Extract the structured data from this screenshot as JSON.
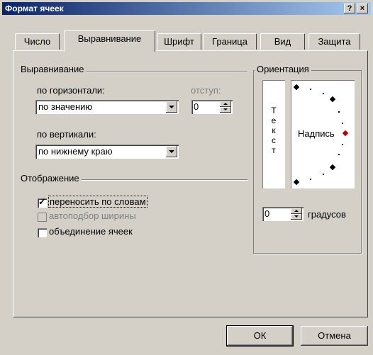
{
  "window": {
    "title": "Формат ячеек",
    "help": "?",
    "close": "×"
  },
  "tabs": [
    {
      "label": "Число",
      "active": false
    },
    {
      "label": "Выравнивание",
      "active": true
    },
    {
      "label": "Шрифт",
      "active": false
    },
    {
      "label": "Граница",
      "active": false
    },
    {
      "label": "Вид",
      "active": false
    },
    {
      "label": "Защита",
      "active": false
    }
  ],
  "alignment": {
    "group_label": "Выравнивание",
    "horizontal_label": "по горизонтали:",
    "horizontal_value": "по значению",
    "indent_label": "отступ:",
    "indent_value": "0",
    "vertical_label": "по вертикали:",
    "vertical_value": "по нижнему краю"
  },
  "display": {
    "group_label": "Отображение",
    "wrap_label": "переносить по словам",
    "wrap_checked": true,
    "autofit_label": "автоподбор ширины",
    "autofit_enabled": false,
    "merge_label": "объединение ячеек",
    "merge_checked": false
  },
  "orientation": {
    "group_label": "Ориентация",
    "vertical_text_letters": [
      "Т",
      "е",
      "к",
      "с",
      "т"
    ],
    "inscription": "Надпись",
    "degrees_value": "0",
    "degrees_label": "градусов",
    "marker_color": "#c00000"
  },
  "buttons": {
    "ok": "ОК",
    "cancel": "Отмена"
  }
}
